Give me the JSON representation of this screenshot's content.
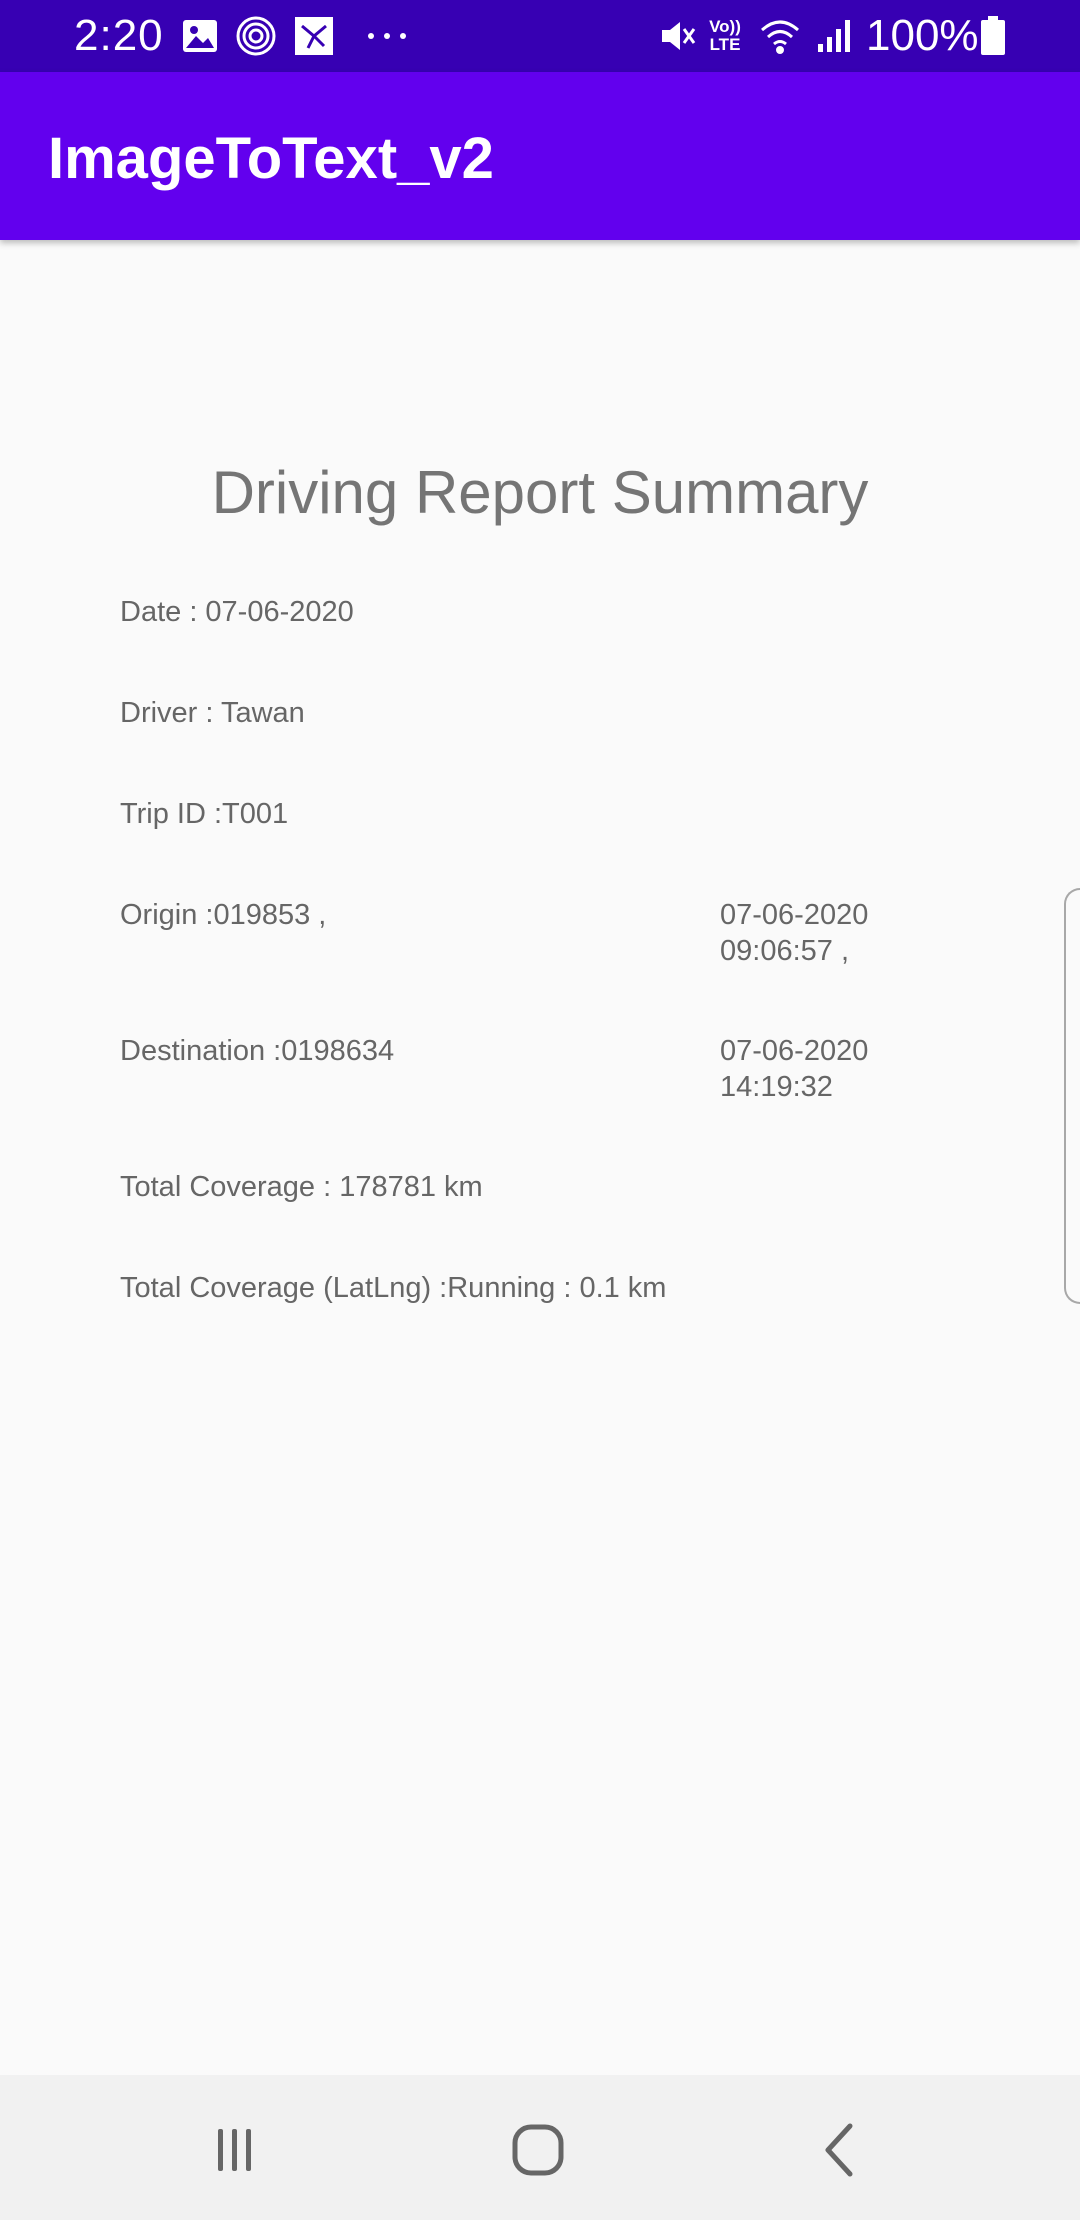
{
  "status_bar": {
    "time": "2:20",
    "battery": "100%",
    "left_icons": [
      "gallery-icon",
      "fingerprint-icon",
      "app-notification-icon",
      "more-notifications-icon"
    ],
    "right_icons": [
      "mute-icon",
      "volte-icon",
      "wifi-icon",
      "signal-icon",
      "battery-icon"
    ],
    "volte_label_top": "Vo))",
    "volte_label_bottom": "LTE"
  },
  "app_bar": {
    "title": "ImageToText_v2"
  },
  "report": {
    "title": "Driving Report Summary",
    "date": "Date : 07-06-2020",
    "driver": "Driver : Tawan",
    "trip_id": "Trip ID :T001",
    "origin": "Origin :019853 ,",
    "origin_time": "07-06-2020\n09:06:57 ,",
    "destination": "Destination :0198634",
    "destination_time": "07-06-2020\n14:19:32",
    "total_coverage": "Total Coverage : 178781 km",
    "total_coverage_latlng": "Total Coverage (LatLng) :Running : 0.1 km"
  },
  "nav_bar": {
    "buttons": [
      "recent-apps",
      "home",
      "back"
    ]
  },
  "colors": {
    "status_bar": "#3700b3",
    "app_bar": "#6200ee",
    "background": "#fafafa",
    "text": "#666666"
  }
}
